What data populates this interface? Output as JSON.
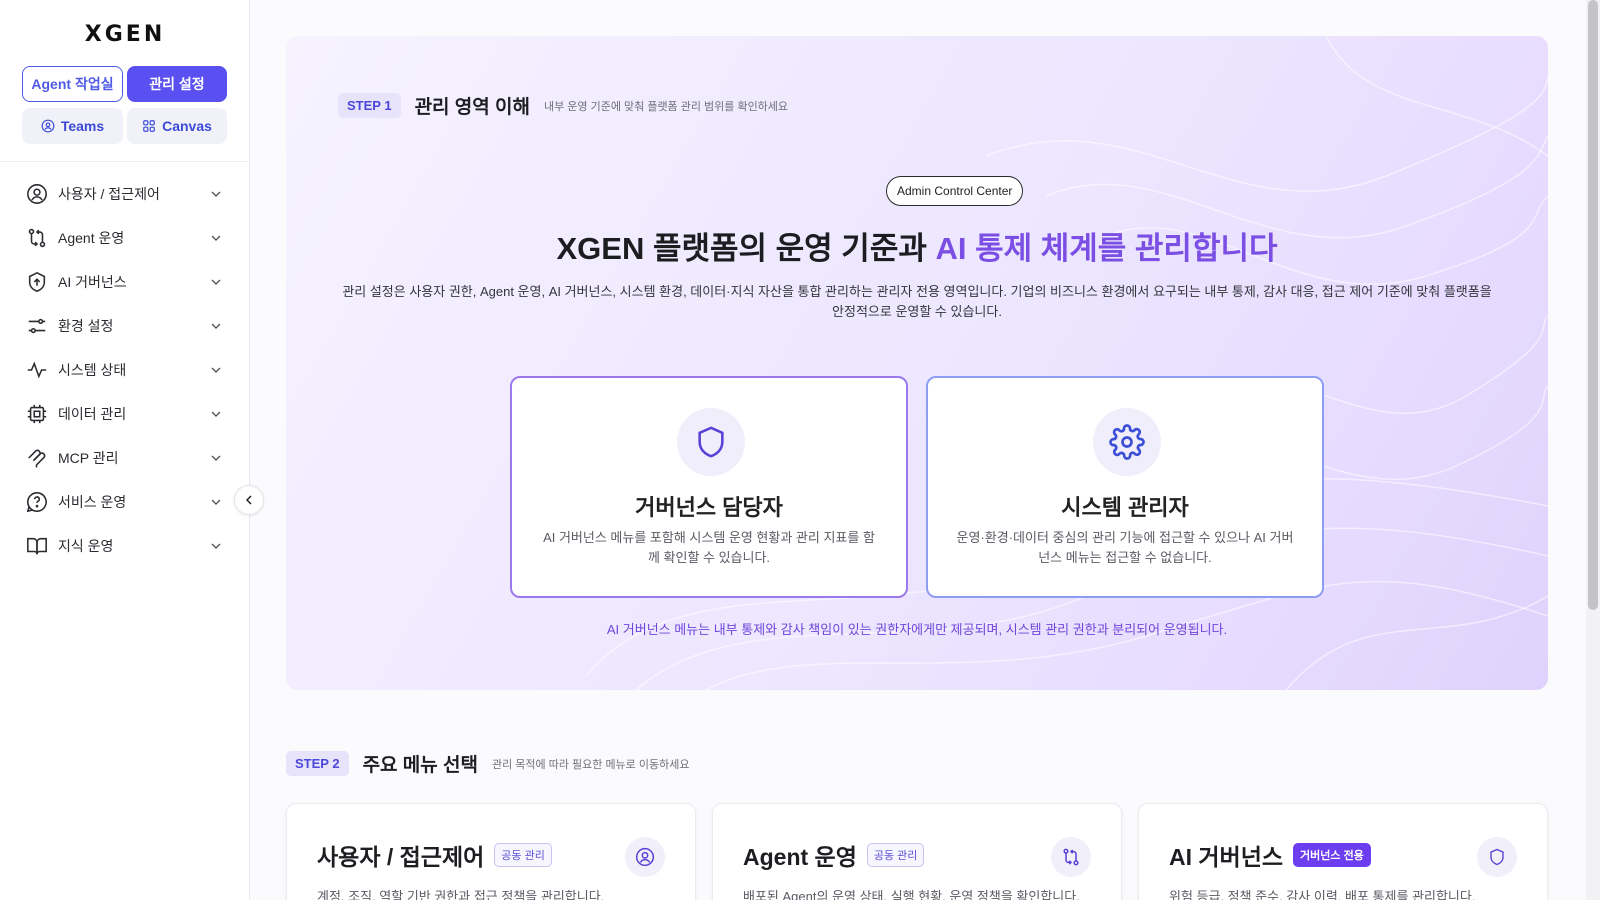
{
  "app": {
    "logo": "XGEN"
  },
  "header_buttons": {
    "agent_workspace": "Agent 작업실",
    "admin_settings": "관리 설정",
    "teams": "Teams",
    "canvas": "Canvas"
  },
  "sidebar": {
    "items": [
      {
        "label": "사용자 / 접근제어",
        "icon": "user-circle-icon"
      },
      {
        "label": "Agent 운영",
        "icon": "workflow-icon"
      },
      {
        "label": "AI 거버넌스",
        "icon": "shield-arrow-icon"
      },
      {
        "label": "환경 설정",
        "icon": "sliders-icon"
      },
      {
        "label": "시스템 상태",
        "icon": "activity-icon"
      },
      {
        "label": "데이터 관리",
        "icon": "chip-icon"
      },
      {
        "label": "MCP 관리",
        "icon": "mcp-icon"
      },
      {
        "label": "서비스 운영",
        "icon": "help-circle-icon"
      },
      {
        "label": "지식 운영",
        "icon": "book-icon"
      }
    ]
  },
  "step1": {
    "badge": "STEP 1",
    "title": "관리 영역 이해",
    "desc": "내부 운영 기준에 맞춰 플랫폼 관리 범위를 확인하세요",
    "pill": "Admin Control Center",
    "hero_title_main": "XGEN 플랫폼의 운영 기준과 ",
    "hero_title_accent": "AI 통제 체계를 관리합니다",
    "hero_desc": "관리 설정은 사용자 권한, Agent 운영, AI 거버넌스, 시스템 환경, 데이터·지식 자산을 통합 관리하는 관리자 전용 영역입니다. 기업의 비즈니스 환경에서 요구되는 내부 통제, 감사 대응, 접근 제어 기준에 맞춰 플랫폼을 안정적으로 운영할 수 있습니다.",
    "roles": [
      {
        "title": "거버넌스 담당자",
        "desc": "AI 거버넌스 메뉴를 포함해 시스템 운영 현황과 관리 지표를 함께 확인할 수 있습니다.",
        "icon": "shield-icon"
      },
      {
        "title": "시스템 관리자",
        "desc": "운영·환경·데이터 중심의 관리 기능에 접근할 수 있으나 AI 거버넌스 메뉴는 접근할 수 없습니다.",
        "icon": "gear-icon"
      }
    ],
    "note": "AI 거버넌스 메뉴는 내부 통제와 감사 책임이 있는 권한자에게만 제공되며, 시스템 관리 권한과 분리되어 운영됩니다."
  },
  "step2": {
    "badge": "STEP 2",
    "title": "주요 메뉴 선택",
    "desc": "관리 목적에 따라 필요한 메뉴로 이동하세요",
    "cards": [
      {
        "title": "사용자 / 접근제어",
        "tag": "공동 관리",
        "desc": "계정, 조직, 역할 기반 권한과 접근 정책을 관리합니다.",
        "icon": "user-circle-icon"
      },
      {
        "title": "Agent 운영",
        "tag": "공동 관리",
        "desc": "배포된 Agent의 운영 상태, 실행 현황, 운영 정책을 확인합니다.",
        "icon": "workflow-icon"
      },
      {
        "title": "AI 거버넌스",
        "tag": "거버넌스 전용",
        "desc": "위험 등급, 정책 준수, 감사 이력, 배포 통제를 관리합니다.",
        "icon": "shield-icon"
      }
    ]
  },
  "colors": {
    "accent": "#5a4ff0",
    "purple": "#7b4ee4"
  }
}
